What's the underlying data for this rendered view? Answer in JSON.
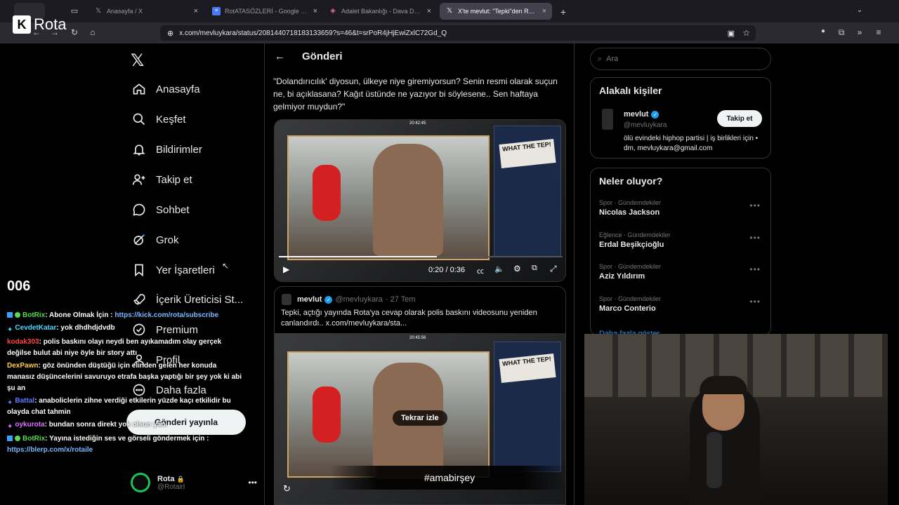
{
  "browser": {
    "tabs": [
      {
        "title": "Anasayfa / X",
        "icon": "x-logo"
      },
      {
        "title": "RotATASÖZLERİ - Google Doküm",
        "icon": "docs"
      },
      {
        "title": "Adalet Bakanlığı - Dava Dosyası",
        "icon": "gov"
      },
      {
        "title": "X'te mevlut: \"Tepki\"den Rota'ya",
        "icon": "x-logo"
      }
    ],
    "url": "x.com/mevluykara/status/2081440718183133659?s=46&t=srPoR4jHjEwiZxlC72Gd_Q"
  },
  "stream": {
    "logo": "Rota",
    "hashtag": "#amabirşey",
    "counter": "006"
  },
  "sidebar": {
    "items": [
      {
        "label": "Anasayfa",
        "icon": "home-icon"
      },
      {
        "label": "Keşfet",
        "icon": "search-icon"
      },
      {
        "label": "Bildirimler",
        "icon": "bell-icon"
      },
      {
        "label": "Takip et",
        "icon": "add-person-icon"
      },
      {
        "label": "Sohbet",
        "icon": "chat-icon"
      },
      {
        "label": "Grok",
        "icon": "grok-icon"
      },
      {
        "label": "Yer İşaretleri",
        "icon": "bookmark-icon"
      },
      {
        "label": "İçerik Üreticisi St...",
        "icon": "rocket-icon"
      },
      {
        "label": "Premium",
        "icon": "verified-icon"
      },
      {
        "label": "Profil",
        "icon": "profile-icon"
      },
      {
        "label": "Daha fazla",
        "icon": "more-circle-icon"
      }
    ],
    "post_button": "Gönderi yayınla",
    "account": {
      "name": "Rota",
      "handle": "@Rotairl"
    }
  },
  "post": {
    "header": "Gönderi",
    "text": "\"Dolandırıcılık' diyosun, ülkeye niye giremiyorsun? Senin resmi olarak suçun ne, bi açıklasana? Kağıt üstünde ne yazıyor bi söylesene.. Sen haftaya gelmiyor muydun?\"",
    "video": {
      "time": "0:20 / 0:36",
      "progress": 0.556,
      "timestamp": "20:42:45",
      "side_text": "WHAT THE TEP!"
    },
    "quote": {
      "name": "mevlut",
      "handle": "@mevluykara",
      "date": "· 27 Tem",
      "text": "Tepki, açtığı yayında Rota'ya cevap olarak polis baskını videosunu yeniden canlandırdı..  x.com/mevluykara/sta...",
      "timestamp": "20:45:56",
      "replay": "Tekrar izle"
    }
  },
  "right": {
    "search_placeholder": "Ara",
    "people_title": "Alakalı kişiler",
    "person": {
      "name": "mevlut",
      "handle": "@mevluykara",
      "bio": "ölü evindeki hiphop partisi | iş birlikleri için • dm, mevluykara@gmail.com",
      "follow": "Takip et"
    },
    "trends_title": "Neler oluyor?",
    "trends": [
      {
        "category": "Spor · Gündemdekiler",
        "name": "Nicolas Jackson"
      },
      {
        "category": "Eğlence · Gündemdekiler",
        "name": "Erdal Beşikçioğlu"
      },
      {
        "category": "Spor · Gündemdekiler",
        "name": "Aziz Yıldırım"
      },
      {
        "category": "Spor · Gündemdekiler",
        "name": "Marco Conterio"
      }
    ],
    "more": "Daha fazla göster"
  },
  "chat": [
    {
      "user": "BotRix",
      "color": "#57d957",
      "msg": ": Abone Olmak İçin : ",
      "link": "https://kick.com/rota/subscribe"
    },
    {
      "user": "CevdetKatar",
      "color": "#4fd6ff",
      "msg": ": yok dhdhdjdvdb",
      "link": ""
    },
    {
      "user": "kodak303",
      "color": "#ff4444",
      "msg": ": polis baskını olayı neydi ben ayıkamadım olay gerçek değilse bulut abi niye öyle bir story attı",
      "link": ""
    },
    {
      "user": "DexPawn",
      "color": "#ffd24a",
      "msg": ": göz önünden düştüğü için elinden gelen her konuda manasız düşüncelerini savuruyo etrafa başka yaptığı bir şey yok ki abi şu an",
      "link": ""
    },
    {
      "user": "Battal",
      "color": "#5e7bff",
      "msg": ": anaboliclerin zihne verdiği etkilerin yüzde kaçı etkilidir bu olayda chat tahmin",
      "link": ""
    },
    {
      "user": "oykurota",
      "color": "#e070ff",
      "msg": ": bundan sonra direkt yok olsun yani",
      "link": ""
    },
    {
      "user": "BotRix",
      "color": "#57d957",
      "msg": ": Yayına istediğin ses ve görseli göndermek için : ",
      "link": "https://blerp.com/x/rotaile"
    }
  ]
}
